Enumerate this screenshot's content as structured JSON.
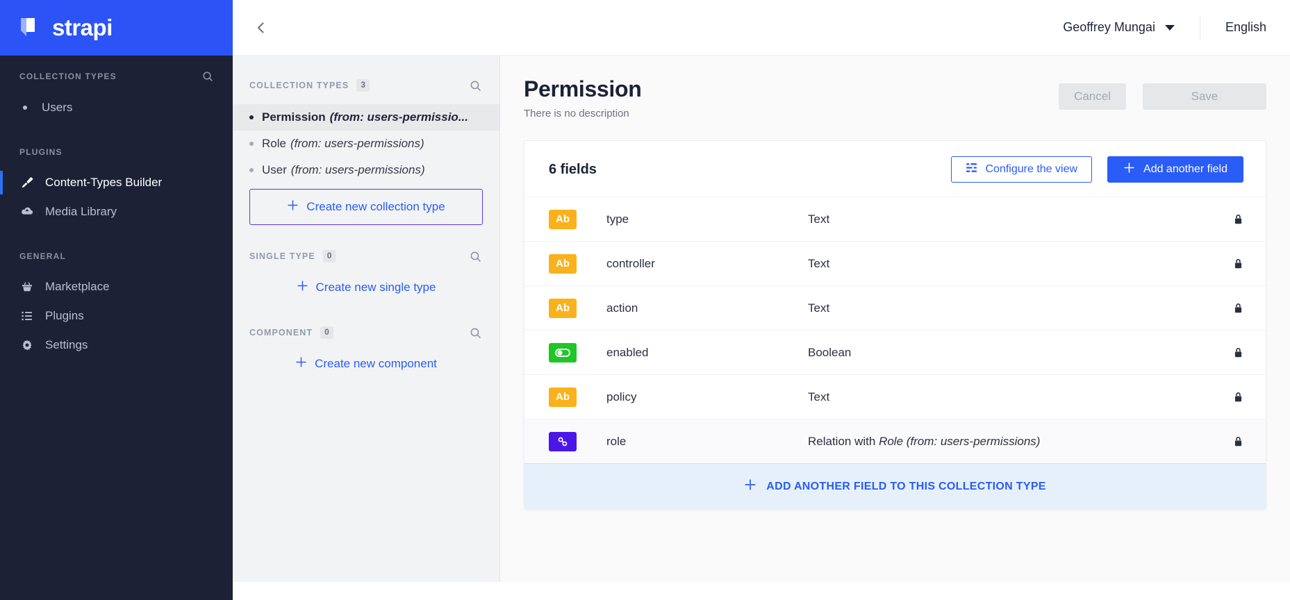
{
  "brand": {
    "name": "strapi",
    "logo_icon": "strapi-logo-icon"
  },
  "sidebar": {
    "sections": [
      {
        "title": "COLLECTION TYPES",
        "search_icon": "search-icon",
        "items": [
          {
            "label": "Users",
            "icon": "bullet-dot-icon",
            "active": false
          }
        ]
      },
      {
        "title": "PLUGINS",
        "items": [
          {
            "label": "Content-Types Builder",
            "icon": "paint-brush-icon",
            "active": true
          },
          {
            "label": "Media Library",
            "icon": "cloud-upload-icon",
            "active": false
          }
        ]
      },
      {
        "title": "GENERAL",
        "items": [
          {
            "label": "Marketplace",
            "icon": "shopping-basket-icon",
            "active": false
          },
          {
            "label": "Plugins",
            "icon": "list-icon",
            "active": false
          },
          {
            "label": "Settings",
            "icon": "gear-icon",
            "active": false
          }
        ]
      }
    ]
  },
  "midpanel": {
    "back_icon": "chevron-left-icon",
    "collection_types": {
      "title": "COLLECTION TYPES",
      "count": "3",
      "search_icon": "search-icon",
      "items": [
        {
          "name": "Permission",
          "source": "(from: users-permissio...",
          "selected": true
        },
        {
          "name": "Role",
          "source": "(from: users-permissions)",
          "selected": false
        },
        {
          "name": "User",
          "source": "(from: users-permissions)",
          "selected": false
        }
      ],
      "create_label": "Create new collection type",
      "create_icon": "plus-icon"
    },
    "single_type": {
      "title": "SINGLE TYPE",
      "count": "0",
      "search_icon": "search-icon",
      "create_label": "Create new single type",
      "create_icon": "plus-icon"
    },
    "component": {
      "title": "COMPONENT",
      "count": "0",
      "search_icon": "search-icon",
      "create_label": "Create new component",
      "create_icon": "plus-icon"
    }
  },
  "topbar": {
    "user_name": "Geoffrey Mungai",
    "user_caret_icon": "chevron-down-icon",
    "language": "English"
  },
  "page": {
    "title": "Permission",
    "subtitle": "There is no description",
    "cancel_label": "Cancel",
    "save_label": "Save"
  },
  "fields_card": {
    "title": "6 fields",
    "configure_label": "Configure the view",
    "configure_icon": "layout-list-icon",
    "add_field_label": "Add another field",
    "add_field_icon": "plus-icon",
    "lock_icon": "lock-icon",
    "rows": [
      {
        "tag": "Ab",
        "tag_color": "#f9b21c",
        "tag_icon": "text-field-icon",
        "name": "type",
        "type_prefix": "Text",
        "type_italic": "",
        "locked": true,
        "highlight": false
      },
      {
        "tag": "Ab",
        "tag_color": "#f9b21c",
        "tag_icon": "text-field-icon",
        "name": "controller",
        "type_prefix": "Text",
        "type_italic": "",
        "locked": true,
        "highlight": false
      },
      {
        "tag": "Ab",
        "tag_color": "#f9b21c",
        "tag_icon": "text-field-icon",
        "name": "action",
        "type_prefix": "Text",
        "type_italic": "",
        "locked": true,
        "highlight": false
      },
      {
        "tag": "",
        "tag_color": "#1ec626",
        "tag_icon": "toggle-switch-icon",
        "name": "enabled",
        "type_prefix": "Boolean",
        "type_italic": "",
        "locked": true,
        "highlight": false
      },
      {
        "tag": "Ab",
        "tag_color": "#f9b21c",
        "tag_icon": "text-field-icon",
        "name": "policy",
        "type_prefix": "Text",
        "type_italic": "",
        "locked": true,
        "highlight": false
      },
      {
        "tag": "",
        "tag_color": "#4b16e8",
        "tag_icon": "relation-link-icon",
        "name": "role",
        "type_prefix": "Relation with ",
        "type_italic": "Role (from: users-permissions)",
        "locked": true,
        "highlight": true
      }
    ],
    "add_banner_label": "ADD ANOTHER FIELD TO THIS COLLECTION TYPE",
    "add_banner_icon": "plus-icon"
  },
  "colors": {
    "brand_blue": "#2b53f5",
    "sidebar_dark": "#1c2135",
    "accent_blue": "#2a5cf7",
    "purple_border": "#5b35e8"
  }
}
